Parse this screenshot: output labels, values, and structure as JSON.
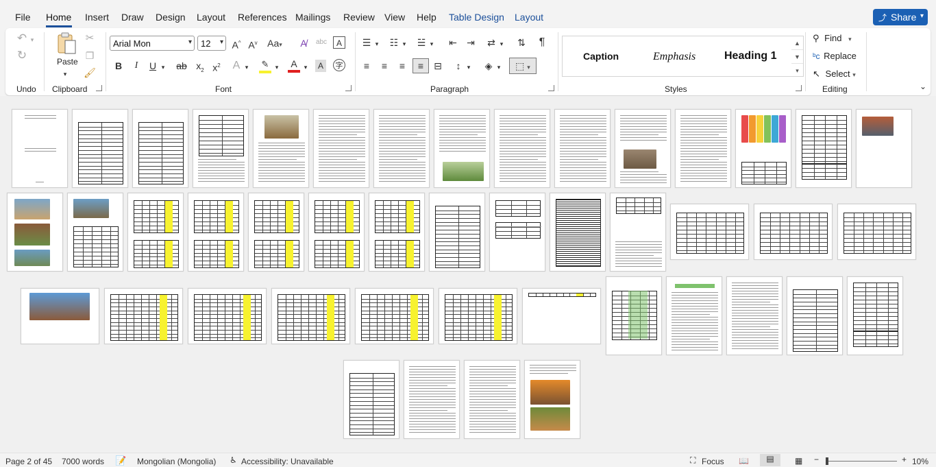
{
  "menu": {
    "tabs": [
      {
        "label": "File"
      },
      {
        "label": "Home"
      },
      {
        "label": "Insert"
      },
      {
        "label": "Draw"
      },
      {
        "label": "Design"
      },
      {
        "label": "Layout"
      },
      {
        "label": "References"
      },
      {
        "label": "Mailings"
      },
      {
        "label": "Review"
      },
      {
        "label": "View"
      },
      {
        "label": "Help"
      },
      {
        "label": "Table Design"
      },
      {
        "label": "Layout"
      }
    ],
    "share_label": "Share"
  },
  "ribbon": {
    "groups": {
      "undo": "Undo",
      "clipboard": "Clipboard",
      "font": "Font",
      "paragraph": "Paragraph",
      "styles": "Styles",
      "editing": "Editing"
    },
    "paste_label": "Paste",
    "font_name": "Arial Mon",
    "font_size": "12",
    "styles": [
      "Caption",
      "Emphasis",
      "Heading 1"
    ],
    "editing": {
      "find": "Find",
      "replace": "Replace",
      "select": "Select"
    }
  },
  "status": {
    "page": "Page 2 of 45",
    "words": "7000 words",
    "language": "Mongolian (Mongolia)",
    "accessibility": "Accessibility: Unavailable",
    "focus": "Focus",
    "zoom": "10%"
  },
  "colors": {
    "accent": "#1b4f9a",
    "share": "#1b60b4",
    "highlight_yellow": "#f7f22f",
    "font_red": "#e02020"
  }
}
